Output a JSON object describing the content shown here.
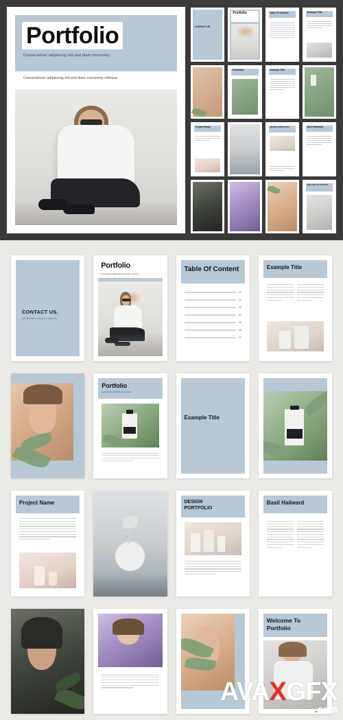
{
  "document": {
    "title": "Portfolio",
    "cover": {
      "title": "Portfolio",
      "subtitle_1": "Consectetuer adipiscing elit,sed diam nonummy.",
      "subtitle_2": "Consectetuer adipiscing elit,sed diam nonummy nibhsus"
    }
  },
  "thumbnail_strip": {
    "rows": [
      [
        {
          "name": "contact-us",
          "label": "CONTACT US.",
          "style": "band"
        },
        {
          "name": "portfolio-cover",
          "label": "Portfolio",
          "style": "photo-title"
        },
        {
          "name": "table-of-content",
          "label": "Table Of Content",
          "style": "toc"
        },
        {
          "name": "example-title",
          "label": "Example Title",
          "style": "text-photo"
        }
      ],
      [
        {
          "name": "face-leaf",
          "label": "",
          "style": "photo-skin"
        },
        {
          "name": "portfolio-green",
          "label": "Portfolio",
          "style": "photo-green"
        },
        {
          "name": "example-title-2",
          "label": "Example Title",
          "style": "text"
        },
        {
          "name": "bottle-green",
          "label": "",
          "style": "photo-green"
        }
      ],
      [
        {
          "name": "project-name",
          "label": "Project Name",
          "style": "text"
        },
        {
          "name": "vase-photo",
          "label": "",
          "style": "photo-grey"
        },
        {
          "name": "design-portfolio",
          "label": "DESIGN PORTFOLIO",
          "style": "text-photo"
        },
        {
          "name": "basil-hailward",
          "label": "Basil Hailward",
          "style": "text"
        }
      ],
      [
        {
          "name": "dark-portrait",
          "label": "",
          "style": "photo-dark"
        },
        {
          "name": "purple-portrait",
          "label": "",
          "style": "photo-purple"
        },
        {
          "name": "skin-leaf-portrait",
          "label": "",
          "style": "photo-skin"
        },
        {
          "name": "welcome-to-portfolio",
          "label": "Welcome To Portfolio",
          "style": "text-photo"
        }
      ]
    ]
  },
  "spreads": {
    "row1": [
      {
        "name": "contact-us-page",
        "title": "CONTACT US.",
        "small": "306.555.0556\nconsectetuer adipiscing"
      },
      {
        "name": "portfolio-cover-page",
        "title": "Portfolio",
        "small": "Consectetuer adipiscing elit,sed diam nonummy"
      },
      {
        "name": "table-of-content-page",
        "title": "Table Of Content",
        "rows": [
          {
            "label": "Lorem ipsum dolor sit amet",
            "page": "01"
          },
          {
            "label": "Lorem ipsum dolor sit amet",
            "page": "02"
          },
          {
            "label": "Lorem ipsum dolor sit amet",
            "page": "03"
          },
          {
            "label": "Lorem ipsum dolor sit amet",
            "page": "04"
          },
          {
            "label": "Lorem ipsum dolor sit amet",
            "page": "05"
          },
          {
            "label": "Lorem ipsum dolor sit amet",
            "page": "06"
          },
          {
            "label": "Lorem ipsum dolor sit amet",
            "page": "07"
          }
        ]
      },
      {
        "name": "example-title-page",
        "title": "Example Title",
        "small": "Lorem ipsum dolor sit amet, consectetuer adipiscing elit"
      }
    ],
    "row2": [
      {
        "name": "face-leaf-page",
        "title": ""
      },
      {
        "name": "portfolio-green-page",
        "title": "Portfolio",
        "small": "Consectetuer adipiscing elit sed diam"
      },
      {
        "name": "example-title-page-2",
        "title": "Example Title",
        "small": "Lorem ipsum dolor sit amet consectetuer"
      },
      {
        "name": "bottle-green-page",
        "title": ""
      }
    ],
    "row3": [
      {
        "name": "project-name-page",
        "title": "Project Name",
        "small": "Lorem ipsum dolor sit amet, consectetuer adipiscing elit, sed diam nonummy nibh euismod"
      },
      {
        "name": "vase-page",
        "title": ""
      },
      {
        "name": "design-portfolio-page",
        "title": "DESIGN PORTFOLIO",
        "small": "Lorem ipsum dolor sit amet consectetuer adipiscing elit"
      },
      {
        "name": "basil-hailward-page",
        "title": "Basil Hailward",
        "small": "Lorem ipsum dolor sit amet, consectetuer adipiscing elit sed diam nonummy"
      }
    ],
    "row4": [
      {
        "name": "dark-portrait-page",
        "title": ""
      },
      {
        "name": "purple-portrait-page",
        "title": ""
      },
      {
        "name": "skin-leaf-page",
        "title": ""
      },
      {
        "name": "welcome-page",
        "title": "Welcome To Portfolio"
      }
    ]
  },
  "watermark": {
    "main_a": "AVA",
    "main_x": "X",
    "main_b": "GFX",
    "dot": ".",
    "com": "com"
  },
  "colors": {
    "accent_blue": "#b7c8d6",
    "background_light": "#eceae6",
    "background_dark": "#3a3a3a",
    "watermark_red": "#e8342a"
  }
}
